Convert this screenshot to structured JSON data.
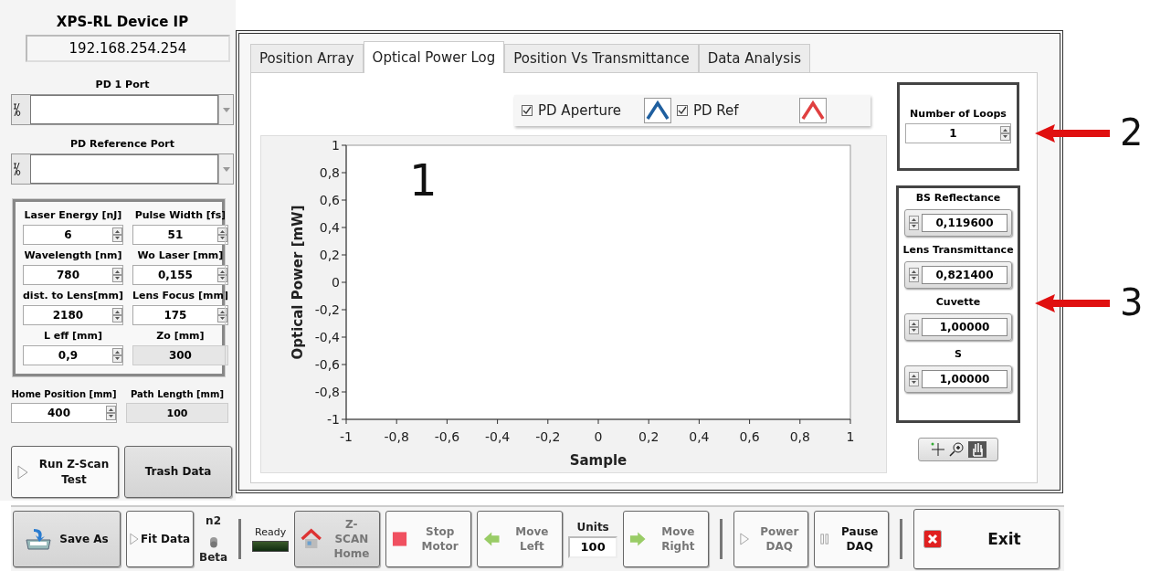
{
  "device_ip": {
    "label": "XPS-RL Device IP",
    "value": "192.168.254.254"
  },
  "ports": [
    {
      "label": "PD 1 Port"
    },
    {
      "label": "PD Reference Port"
    }
  ],
  "parameters": [
    {
      "label": "Laser Energy [nJ]",
      "value": "6",
      "kind": "control"
    },
    {
      "label": "Pulse Width [fs]",
      "value": "51",
      "kind": "control"
    },
    {
      "label": "Wavelength [nm]",
      "value": "780",
      "kind": "control"
    },
    {
      "label": "Wo Laser [mm]",
      "value": "0,155",
      "kind": "control"
    },
    {
      "label": "dist. to Lens[mm]",
      "value": "2180",
      "kind": "control"
    },
    {
      "label": "Lens Focus [mm]",
      "value": "175",
      "kind": "control"
    },
    {
      "label": "L eff [mm]",
      "value": "0,9",
      "kind": "control"
    },
    {
      "label": "Zo [mm]",
      "value": "300",
      "kind": "indicator"
    }
  ],
  "home_position": {
    "label": "Home Position [mm]",
    "value": "400"
  },
  "path_length": {
    "label": "Path Length [mm]",
    "value": "100"
  },
  "actions": [
    {
      "label": "Run Z-Scan Test",
      "pressed": false
    },
    {
      "label": "Trash Data",
      "pressed": true
    }
  ],
  "tabs": [
    {
      "label": "Position Array",
      "selected": false
    },
    {
      "label": "Optical Power Log",
      "selected": true
    },
    {
      "label": "Position Vs Transmittance",
      "selected": false
    },
    {
      "label": "Data Analysis",
      "selected": false
    }
  ],
  "legend": [
    {
      "label": "PD Aperture",
      "checked": true,
      "color": "#1f5f9f"
    },
    {
      "label": "PD Ref",
      "checked": true,
      "color": "#e04040"
    }
  ],
  "chart_data": {
    "type": "line",
    "xlabel": "Sample",
    "ylabel": "Optical Power [mW]",
    "xlim": [
      -1,
      1
    ],
    "ylim": [
      -1,
      1
    ],
    "xticks": [
      {
        "value": -1,
        "label": "-1"
      },
      {
        "value": -0.8,
        "label": "-0,8"
      },
      {
        "value": -0.6,
        "label": "-0,6"
      },
      {
        "value": -0.4,
        "label": "-0,4"
      },
      {
        "value": -0.2,
        "label": "-0,2"
      },
      {
        "value": 0,
        "label": "0"
      },
      {
        "value": 0.2,
        "label": "0,2"
      },
      {
        "value": 0.4,
        "label": "0,4"
      },
      {
        "value": 0.6,
        "label": "0,6"
      },
      {
        "value": 0.8,
        "label": "0,8"
      },
      {
        "value": 1,
        "label": "1"
      }
    ],
    "yticks": [
      {
        "value": 1,
        "label": "1"
      },
      {
        "value": 0.8,
        "label": "0,8"
      },
      {
        "value": 0.6,
        "label": "0,6"
      },
      {
        "value": 0.4,
        "label": "0,4"
      },
      {
        "value": 0.2,
        "label": "0,2"
      },
      {
        "value": 0,
        "label": "0"
      },
      {
        "value": -0.2,
        "label": "-0,2"
      },
      {
        "value": -0.4,
        "label": "-0,4"
      },
      {
        "value": -0.6,
        "label": "-0,6"
      },
      {
        "value": -0.8,
        "label": "-0,8"
      },
      {
        "value": -1,
        "label": "-1"
      }
    ],
    "annotations": [
      {
        "text": "1"
      }
    ]
  },
  "loops": {
    "label": "Number of Loops",
    "value": "1"
  },
  "factors": [
    {
      "label": "BS Reflectance",
      "value": "0,119600"
    },
    {
      "label": "Lens Transmittance",
      "value": "0,821400"
    },
    {
      "label": "Cuvette",
      "value": "1,00000"
    },
    {
      "label": "S",
      "value": "1,00000"
    }
  ],
  "callouts": [
    {
      "label": "2"
    },
    {
      "label": "3"
    }
  ],
  "bottom_bar": [
    [
      {
        "kind": "button",
        "label": "Save As",
        "pressed": true,
        "disabled": false
      },
      {
        "kind": "button",
        "label": "Fit Data",
        "pressed": false,
        "disabled": false
      },
      {
        "kind": "switch",
        "top_label": "n2",
        "bottom_label": "Beta",
        "on": false
      }
    ],
    [
      {
        "kind": "led",
        "label": "Ready",
        "on": false
      },
      {
        "kind": "button",
        "label": "Z-SCAN Home",
        "pressed": true,
        "disabled": true
      },
      {
        "kind": "button",
        "label": "Stop Motor",
        "pressed": false,
        "disabled": true
      },
      {
        "kind": "button",
        "label": "Move Left",
        "pressed": false,
        "disabled": true
      },
      {
        "kind": "field",
        "label": "Units",
        "value": "100"
      },
      {
        "kind": "button",
        "label": "Move Right",
        "pressed": false,
        "disabled": true
      }
    ],
    [
      {
        "kind": "button",
        "label": "Power DAQ",
        "pressed": false,
        "disabled": true
      },
      {
        "kind": "button",
        "label": "Pause DAQ",
        "pressed": false,
        "disabled": false
      }
    ],
    [
      {
        "kind": "button",
        "label": "Exit",
        "pressed": false,
        "disabled": false
      }
    ]
  ]
}
